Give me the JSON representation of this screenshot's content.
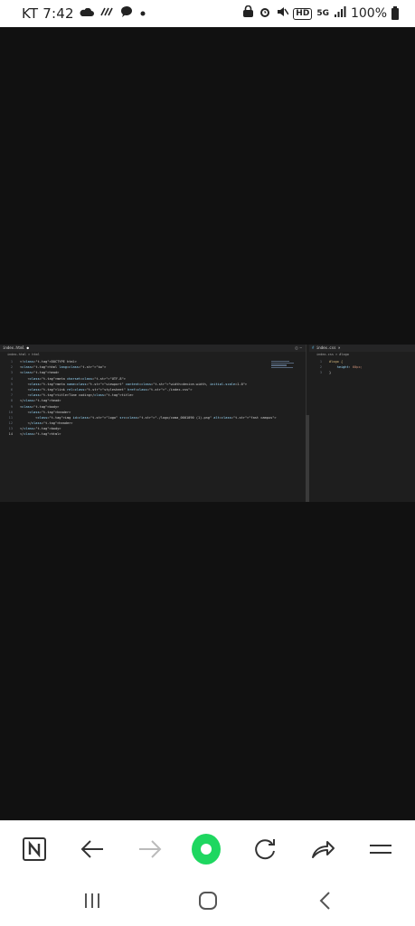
{
  "status_bar": {
    "carrier_time": "KT 7:42",
    "battery_text": "100%",
    "network_badge": "5G",
    "hd_badge": "HD",
    "icons": [
      "cloud-icon",
      "wifi-call-icon",
      "chat-bubble-icon",
      "dot-icon",
      "lock-icon",
      "alarm-icon",
      "mute-icon",
      "hd-voice-icon",
      "network-5g-icon",
      "signal-icon",
      "battery-icon"
    ]
  },
  "editor": {
    "left_tab": "index.html",
    "left_breadcrumb": "index.html > html",
    "right_tab": "index.css",
    "right_breadcrumb": "index.css > #logo",
    "html_lines": [
      {
        "no": "1",
        "code": "<!DOCTYPE html>"
      },
      {
        "no": "2",
        "code": "<html lang=\"ko\">"
      },
      {
        "no": "3",
        "code": "<head>"
      },
      {
        "no": "4",
        "code": "    <meta charset=\"UTF-8\">"
      },
      {
        "no": "5",
        "code": "    <meta name=\"viewport\" content=\"width=device-width, initial-scale=1.0\">"
      },
      {
        "no": "6",
        "code": "    <link rel=\"stylesheet\" href=\"./index.css\">"
      },
      {
        "no": "7",
        "code": "    <title>Time coding</title>"
      },
      {
        "no": "8",
        "code": "</head>"
      },
      {
        "no": "9",
        "code": "<body>"
      },
      {
        "no": "10",
        "code": "    <header>"
      },
      {
        "no": "11",
        "code": "        <img id=\"logo\" src=\"./logo/coma_0001090 (1).png\" alt=\"fast campus\">"
      },
      {
        "no": "12",
        "code": "    </header>"
      },
      {
        "no": "13",
        "code": "</body>"
      },
      {
        "no": "14",
        "code": "</html>"
      }
    ],
    "css_lines": [
      {
        "no": "1",
        "code": "#logo {"
      },
      {
        "no": "2",
        "code": "    height: 60px;"
      },
      {
        "no": "3",
        "code": "}"
      }
    ]
  },
  "browser_bar": {
    "buttons": [
      "naver-n-icon",
      "back-arrow-icon",
      "forward-arrow-icon",
      "home-green-icon",
      "refresh-icon",
      "share-icon",
      "menu-icon"
    ]
  },
  "colors": {
    "accent_green": "#1ed760",
    "editor_bg": "#1e1e1e",
    "page_bg": "#111111"
  }
}
